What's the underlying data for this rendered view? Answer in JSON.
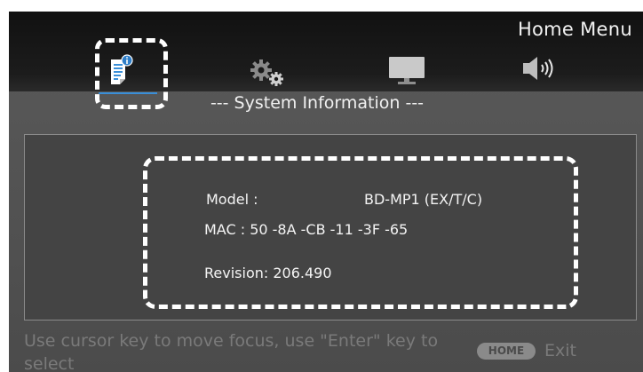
{
  "header": {
    "menu_title": "Home Menu"
  },
  "tabs": [
    {
      "name": "system-information",
      "icon": "document-info-icon",
      "focused": true
    },
    {
      "name": "settings",
      "icon": "gears-icon",
      "focused": false
    },
    {
      "name": "display",
      "icon": "monitor-icon",
      "focused": false
    },
    {
      "name": "audio",
      "icon": "speaker-icon",
      "focused": false
    }
  ],
  "section_title": "--- System Information ---",
  "info": {
    "model_label": "Model :",
    "model_value": "BD-MP1 (EX/T/C)",
    "mac_line": "MAC : 50 -8A -CB -11 -3F -65",
    "revision_line": "Revision:  206.490"
  },
  "footer": {
    "hint": "Use cursor key to move focus, use \"Enter\" key to select",
    "home_badge": "HOME",
    "exit_label": "Exit"
  },
  "colors": {
    "accent": "#3a8fd8",
    "focus_outline": "#ffffff",
    "background": "#4b4b4b",
    "header": "#151515"
  }
}
